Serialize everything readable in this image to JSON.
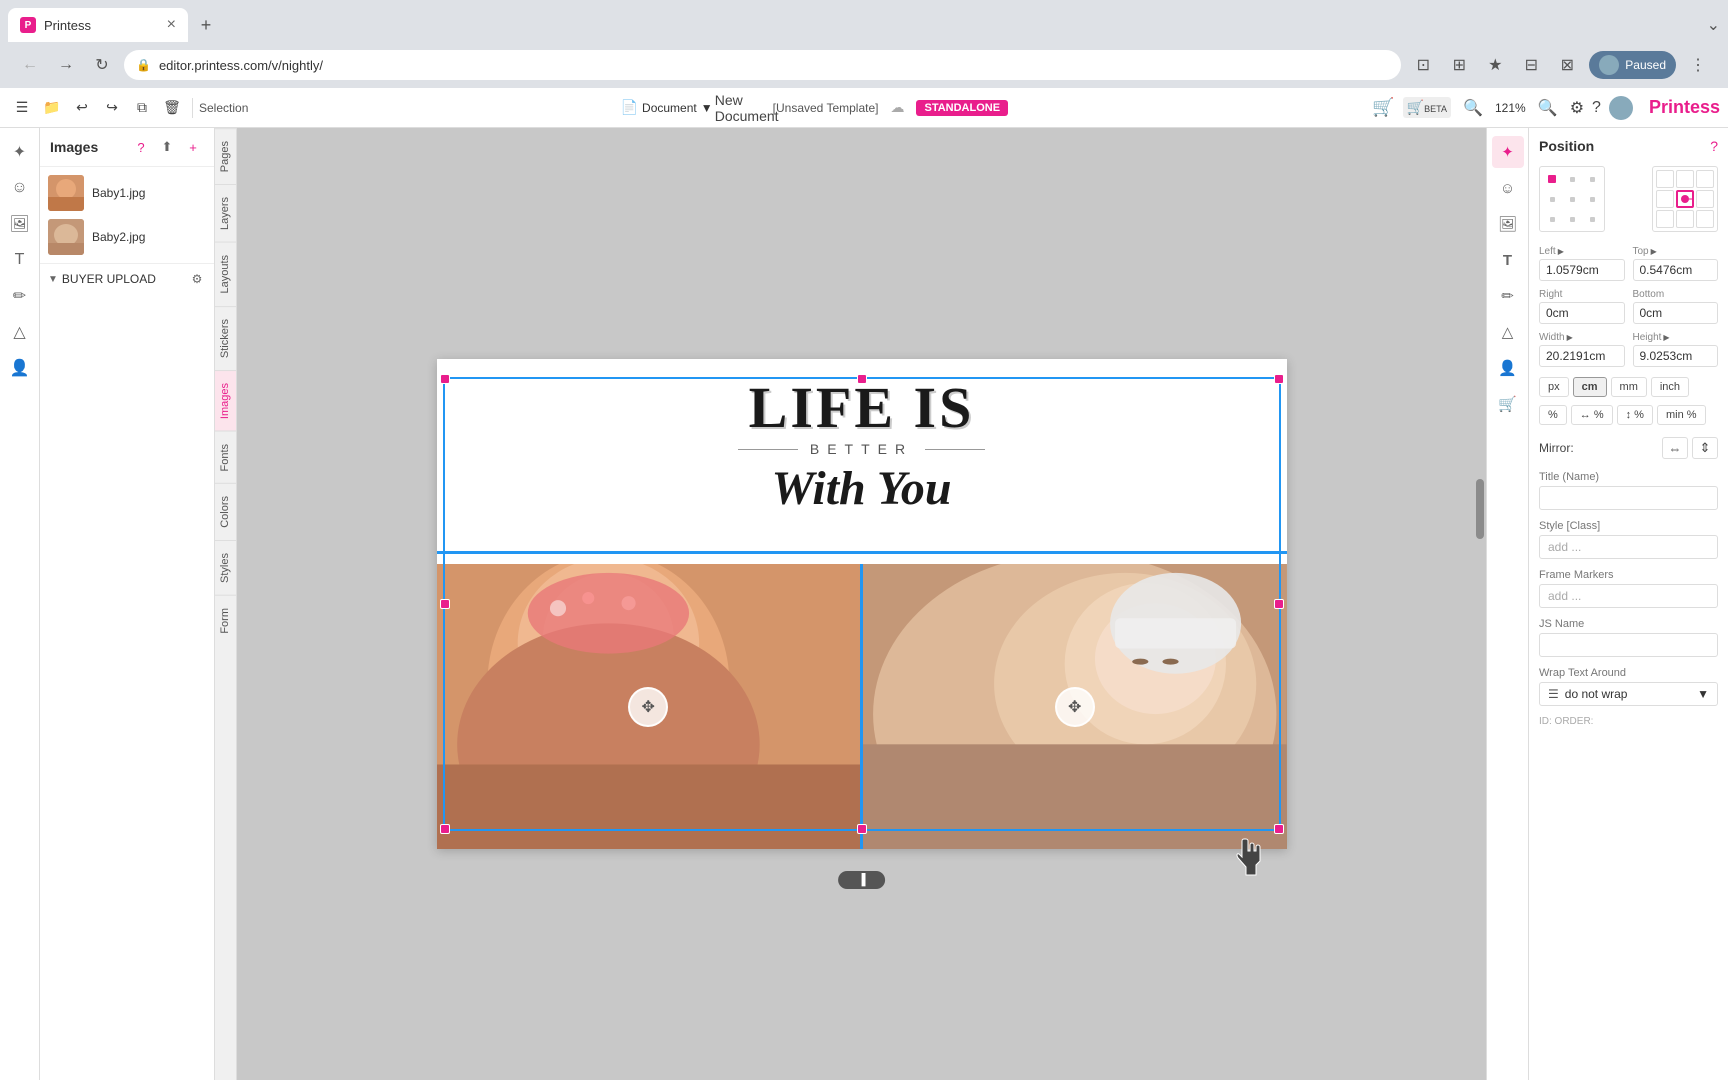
{
  "browser": {
    "tab_title": "Printess",
    "url": "editor.printess.com/v/nightly/",
    "profile_label": "Paused"
  },
  "toolbar": {
    "selection_label": "Selection",
    "unsaved_label": "[Unsaved Template]",
    "standalone_label": "STANDALONE",
    "new_doc_label": "New Document",
    "doc_label": "Document",
    "zoom_label": "121%"
  },
  "images_panel": {
    "title": "Images",
    "images": [
      {
        "name": "Baby1.jpg"
      },
      {
        "name": "Baby2.jpg"
      }
    ],
    "upload_section": "BUYER UPLOAD"
  },
  "vertical_tabs": [
    "Pages",
    "Layers",
    "Layouts",
    "Stickers",
    "Images",
    "Fonts",
    "Colors",
    "Styles",
    "Form"
  ],
  "position_panel": {
    "title": "Position",
    "left_label": "Left",
    "left_value": "1.0579cm",
    "top_label": "Top",
    "top_value": "0.5476cm",
    "right_label": "Right",
    "right_value": "0cm",
    "bottom_label": "Bottom",
    "bottom_value": "0cm",
    "width_label": "Width",
    "width_value": "20.2191cm",
    "height_label": "Height",
    "height_value": "9.0253cm",
    "units": [
      "px",
      "cm",
      "mm",
      "inch"
    ],
    "unit_row2": [
      "%",
      "↔ %",
      "↕ %",
      "min %"
    ],
    "mirror_label": "Mirror:",
    "title_name_label": "Title (Name)",
    "style_class_label": "Style [Class]",
    "style_placeholder": "add ...",
    "frame_markers_label": "Frame Markers",
    "frame_placeholder": "add ...",
    "js_name_label": "JS Name",
    "wrap_label": "Wrap Text Around",
    "wrap_value": "do not wrap",
    "id_order_label": "ID: ORDER:"
  },
  "canvas": {
    "text_line1": "LIFE IS",
    "text_line2": "BETTER",
    "text_line3": "With You",
    "page_nav": "▐"
  },
  "icons": {
    "back": "←",
    "forward": "→",
    "refresh": "↻",
    "home": "⌂",
    "bookmark": "★",
    "profile": "👤",
    "menu": "⋮",
    "undo": "↩",
    "redo": "↪",
    "copy": "⧉",
    "trash": "🗑",
    "document": "📄",
    "cloud": "☁",
    "cart1": "🛒",
    "cart2": "🛒",
    "zoom_in": "🔍",
    "settings": "⚙",
    "help": "?",
    "plus": "+",
    "question": "?",
    "upload": "⬆",
    "gear": "⚙",
    "search": "🔍",
    "star": "★",
    "extensions": "⊞",
    "screenshot": "⊡",
    "window": "⊟"
  }
}
